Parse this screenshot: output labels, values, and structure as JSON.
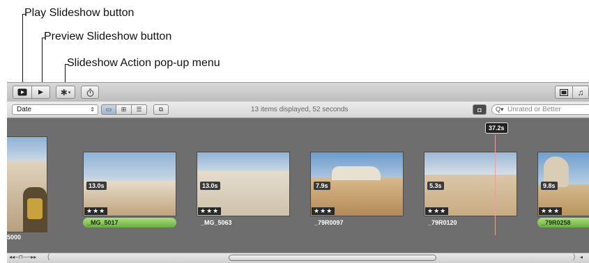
{
  "callouts": {
    "play": "Play Slideshow button",
    "preview": "Preview Slideshow button",
    "action": "Slideshow Action pop-up menu"
  },
  "toolbar": {
    "play_icon": "play-slideshow-icon",
    "preview_icon": "preview-triangle-icon",
    "action_icon": "gear-icon",
    "timer_icon": "stopwatch-icon",
    "right_icons": [
      "viewer-icon",
      "music-note-icon"
    ]
  },
  "filterbar": {
    "sort_value": "Date",
    "status": "13 items displayed, 52 seconds",
    "search_placeholder": "Unrated or Better"
  },
  "browser": {
    "playhead_time": "37.2s",
    "partial_label": "5000",
    "clips": [
      {
        "duration": "13.0s",
        "stars": "★★★",
        "name": "_MG_5017",
        "selected": true
      },
      {
        "duration": "13.0s",
        "stars": "★★★",
        "name": "_MG_5063",
        "selected": false
      },
      {
        "duration": "7.9s",
        "stars": "★★★",
        "name": "_79R0097",
        "selected": false
      },
      {
        "duration": "5.3s",
        "stars": "★★★",
        "name": "_79R0120",
        "selected": false
      },
      {
        "duration": "9.8s",
        "stars": "★★★",
        "name": "_79R0258",
        "selected": true
      }
    ]
  }
}
